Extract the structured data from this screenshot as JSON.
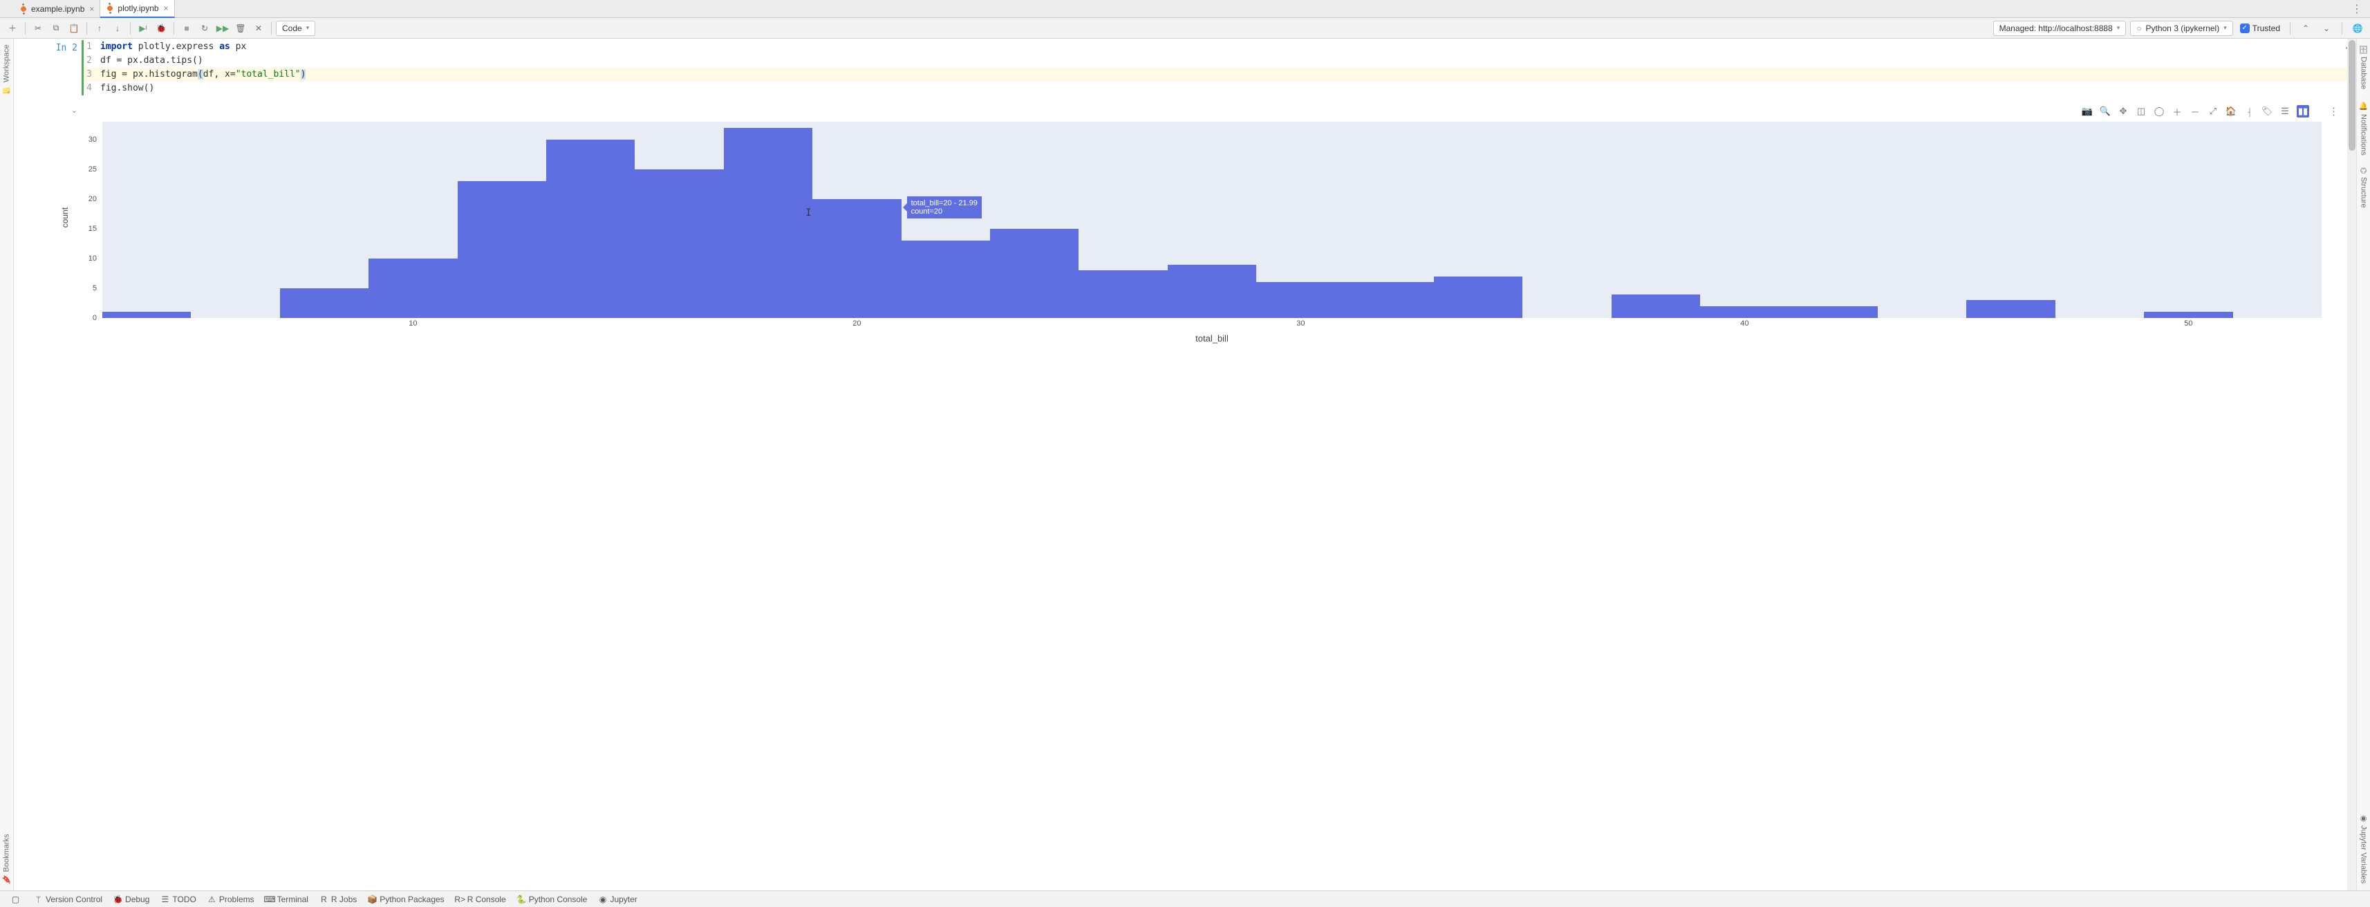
{
  "tabs": [
    {
      "label": "example.ipynb",
      "active": false
    },
    {
      "label": "plotly.ipynb",
      "active": true
    }
  ],
  "toolbar": {
    "cell_type": "Code",
    "managed": "Managed: http://localhost:8888",
    "kernel": "Python 3 (ipykernel)",
    "trusted": "Trusted"
  },
  "cell": {
    "prompt": "In 2",
    "lines": [
      {
        "n": "1",
        "html": "<span class='kw'>import</span> plotly.express <span class='kw'>as</span> px"
      },
      {
        "n": "2",
        "html": "df = px.data.tips()"
      },
      {
        "n": "3",
        "html": "fig = px.histogram<span class='sel-bracket'>(</span>df, x=<span class='str'>\"total_bill\"</span><span class='sel-bracket'>)</span>",
        "hl": true
      },
      {
        "n": "4",
        "html": "fig.show()"
      }
    ]
  },
  "hover": {
    "line1": "total_bill=20 - 21.99",
    "line2": "count=20"
  },
  "chart_data": {
    "type": "bar",
    "title": "",
    "xlabel": "total_bill",
    "ylabel": "count",
    "ylim": [
      0,
      33
    ],
    "xlim": [
      3,
      53
    ],
    "x_ticks": [
      10,
      20,
      30,
      40,
      50
    ],
    "y_ticks": [
      0,
      5,
      10,
      15,
      20,
      25,
      30
    ],
    "bin_edges": [
      3,
      5,
      7,
      9,
      11,
      13,
      15,
      17,
      19,
      21,
      23,
      25,
      27,
      29,
      31,
      33,
      35,
      37,
      39,
      41,
      43,
      45,
      47,
      49,
      51,
      53
    ],
    "values": [
      1,
      0,
      5,
      10,
      23,
      30,
      25,
      32,
      20,
      13,
      15,
      8,
      9,
      6,
      6,
      7,
      0,
      4,
      2,
      2,
      0,
      3,
      0,
      1,
      0
    ],
    "hover_bin_index": 8
  },
  "left_gutter": [
    {
      "label": "Workspace",
      "icon": "folder"
    },
    {
      "label": "Bookmarks",
      "icon": "bookmark"
    }
  ],
  "right_gutter": [
    {
      "label": "Database",
      "icon": "db"
    },
    {
      "label": "Notifications",
      "icon": "bell"
    },
    {
      "label": "Structure",
      "icon": "struct"
    },
    {
      "label": "Jupyter Variables",
      "icon": "jv"
    }
  ],
  "status_bar": [
    {
      "label": "Version Control",
      "icon": "branch"
    },
    {
      "label": "Debug",
      "icon": "bug"
    },
    {
      "label": "TODO",
      "icon": "list"
    },
    {
      "label": "Problems",
      "icon": "warn"
    },
    {
      "label": "Terminal",
      "icon": "term"
    },
    {
      "label": "R Jobs",
      "icon": "r"
    },
    {
      "label": "Python Packages",
      "icon": "pkg"
    },
    {
      "label": "R Console",
      "icon": "rc"
    },
    {
      "label": "Python Console",
      "icon": "py"
    },
    {
      "label": "Jupyter",
      "icon": "jup"
    }
  ]
}
